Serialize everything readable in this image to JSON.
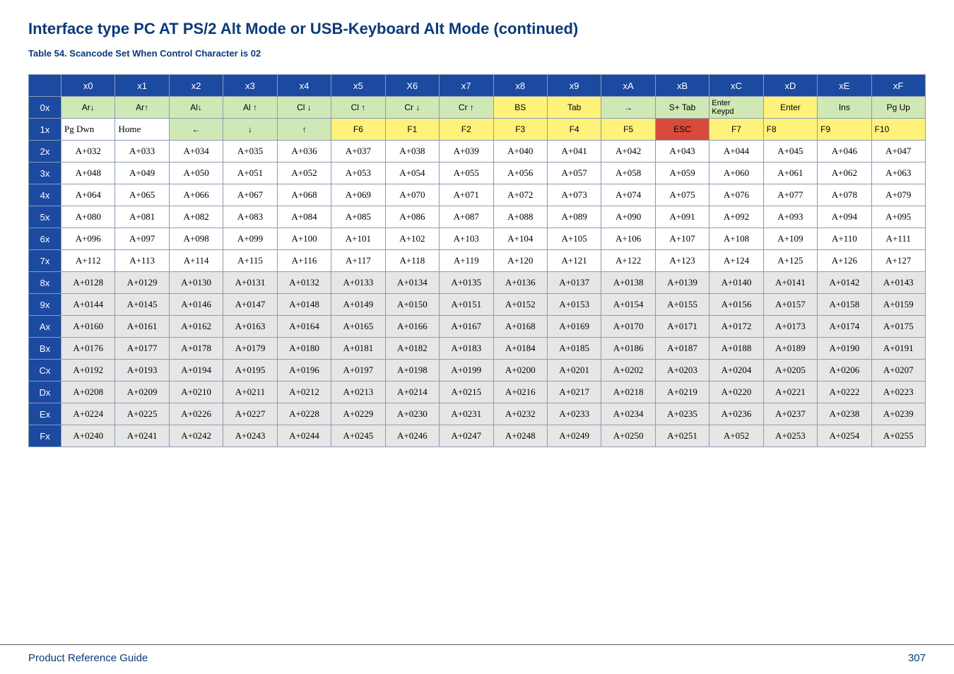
{
  "title": "Interface type PC AT PS/2 Alt Mode or USB-Keyboard Alt Mode (continued)",
  "caption": "Table 54. Scancode Set When Control Character is 02",
  "footer": {
    "left": "Product Reference Guide",
    "page": "307"
  },
  "columns": [
    "",
    "x0",
    "x1",
    "x2",
    "x3",
    "x4",
    "x5",
    "X6",
    "x7",
    "x8",
    "x9",
    "xA",
    "xB",
    "xC",
    "xD",
    "xE",
    "xF"
  ],
  "rows": [
    {
      "head": "0x",
      "shaded": true,
      "cells": [
        {
          "t": "Ar↓",
          "c": "green"
        },
        {
          "t": "Ar↑",
          "c": "green"
        },
        {
          "t": "Al↓",
          "c": "green"
        },
        {
          "t": "Al ↑",
          "c": "green"
        },
        {
          "t": "Cl ↓",
          "c": "green"
        },
        {
          "t": "Cl ↑",
          "c": "green"
        },
        {
          "t": "Cr ↓",
          "c": "green"
        },
        {
          "t": "Cr ↑",
          "c": "green"
        },
        {
          "t": "BS",
          "c": "yellow"
        },
        {
          "t": "Tab",
          "c": "yellow"
        },
        {
          "t": "→",
          "c": "green"
        },
        {
          "t": "S+ Tab",
          "c": "green"
        },
        {
          "t": "Enter Keypd",
          "c": "ec"
        },
        {
          "t": "Enter",
          "c": "yellow"
        },
        {
          "t": "Ins",
          "c": "green"
        },
        {
          "t": "Pg Up",
          "c": "green"
        }
      ]
    },
    {
      "head": "1x",
      "shaded": false,
      "cells": [
        {
          "t": "Pg Dwn",
          "c": "pgdwn"
        },
        {
          "t": "Home",
          "c": "home"
        },
        {
          "t": "←",
          "c": "green"
        },
        {
          "t": "↓",
          "c": "green"
        },
        {
          "t": "↑",
          "c": "green"
        },
        {
          "t": "F6",
          "c": "yellow"
        },
        {
          "t": "F1",
          "c": "yellow"
        },
        {
          "t": "F2",
          "c": "yellow"
        },
        {
          "t": "F3",
          "c": "yellow"
        },
        {
          "t": "F4",
          "c": "yellow"
        },
        {
          "t": "F5",
          "c": "yellow"
        },
        {
          "t": "ESC",
          "c": "red"
        },
        {
          "t": "F7",
          "c": "yellow"
        },
        {
          "t": "F8",
          "c": "yellowL"
        },
        {
          "t": "F9",
          "c": "yellowL"
        },
        {
          "t": "F10",
          "c": "yellowL"
        }
      ]
    },
    {
      "head": "2x",
      "shaded": false,
      "cells": [
        {
          "t": "A+032"
        },
        {
          "t": "A+033"
        },
        {
          "t": "A+034"
        },
        {
          "t": "A+035"
        },
        {
          "t": "A+036"
        },
        {
          "t": "A+037"
        },
        {
          "t": "A+038"
        },
        {
          "t": "A+039"
        },
        {
          "t": "A+040"
        },
        {
          "t": "A+041"
        },
        {
          "t": "A+042"
        },
        {
          "t": "A+043"
        },
        {
          "t": "A+044"
        },
        {
          "t": "A+045"
        },
        {
          "t": "A+046"
        },
        {
          "t": "A+047"
        }
      ]
    },
    {
      "head": "3x",
      "shaded": false,
      "cells": [
        {
          "t": "A+048"
        },
        {
          "t": "A+049"
        },
        {
          "t": "A+050"
        },
        {
          "t": "A+051"
        },
        {
          "t": "A+052"
        },
        {
          "t": "A+053"
        },
        {
          "t": "A+054"
        },
        {
          "t": "A+055"
        },
        {
          "t": "A+056"
        },
        {
          "t": "A+057"
        },
        {
          "t": "A+058"
        },
        {
          "t": "A+059"
        },
        {
          "t": "A+060"
        },
        {
          "t": "A+061"
        },
        {
          "t": "A+062"
        },
        {
          "t": "A+063"
        }
      ]
    },
    {
      "head": "4x",
      "shaded": false,
      "cells": [
        {
          "t": "A+064"
        },
        {
          "t": "A+065"
        },
        {
          "t": "A+066"
        },
        {
          "t": "A+067"
        },
        {
          "t": "A+068"
        },
        {
          "t": "A+069"
        },
        {
          "t": "A+070"
        },
        {
          "t": "A+071"
        },
        {
          "t": "A+072"
        },
        {
          "t": "A+073"
        },
        {
          "t": "A+074"
        },
        {
          "t": "A+075"
        },
        {
          "t": "A+076"
        },
        {
          "t": "A+077"
        },
        {
          "t": "A+078"
        },
        {
          "t": "A+079"
        }
      ]
    },
    {
      "head": "5x",
      "shaded": false,
      "cells": [
        {
          "t": "A+080"
        },
        {
          "t": "A+081"
        },
        {
          "t": "A+082"
        },
        {
          "t": "A+083"
        },
        {
          "t": "A+084"
        },
        {
          "t": "A+085"
        },
        {
          "t": "A+086"
        },
        {
          "t": "A+087"
        },
        {
          "t": "A+088"
        },
        {
          "t": "A+089"
        },
        {
          "t": "A+090"
        },
        {
          "t": "A+091"
        },
        {
          "t": "A+092"
        },
        {
          "t": "A+093"
        },
        {
          "t": "A+094"
        },
        {
          "t": "A+095"
        }
      ]
    },
    {
      "head": "6x",
      "shaded": false,
      "cells": [
        {
          "t": "A+096"
        },
        {
          "t": "A+097"
        },
        {
          "t": "A+098"
        },
        {
          "t": "A+099"
        },
        {
          "t": "A+100"
        },
        {
          "t": "A+101"
        },
        {
          "t": "A+102"
        },
        {
          "t": "A+103"
        },
        {
          "t": "A+104"
        },
        {
          "t": "A+105"
        },
        {
          "t": "A+106"
        },
        {
          "t": "A+107"
        },
        {
          "t": "A+108"
        },
        {
          "t": "A+109"
        },
        {
          "t": "A+110"
        },
        {
          "t": "A+111"
        }
      ]
    },
    {
      "head": "7x",
      "shaded": false,
      "cells": [
        {
          "t": "A+112"
        },
        {
          "t": "A+113"
        },
        {
          "t": "A+114"
        },
        {
          "t": "A+115"
        },
        {
          "t": "A+116"
        },
        {
          "t": "A+117"
        },
        {
          "t": "A+118"
        },
        {
          "t": "A+119"
        },
        {
          "t": "A+120"
        },
        {
          "t": "A+121"
        },
        {
          "t": "A+122"
        },
        {
          "t": "A+123"
        },
        {
          "t": "A+124"
        },
        {
          "t": "A+125"
        },
        {
          "t": "A+126"
        },
        {
          "t": "A+127"
        }
      ]
    },
    {
      "head": "8x",
      "shaded": true,
      "cells": [
        {
          "t": "A+0128"
        },
        {
          "t": "A+0129"
        },
        {
          "t": "A+0130"
        },
        {
          "t": "A+0131"
        },
        {
          "t": "A+0132"
        },
        {
          "t": "A+0133"
        },
        {
          "t": "A+0134"
        },
        {
          "t": "A+0135"
        },
        {
          "t": "A+0136"
        },
        {
          "t": "A+0137"
        },
        {
          "t": "A+0138"
        },
        {
          "t": "A+0139"
        },
        {
          "t": "A+0140"
        },
        {
          "t": "A+0141"
        },
        {
          "t": "A+0142"
        },
        {
          "t": "A+0143"
        }
      ]
    },
    {
      "head": "9x",
      "shaded": true,
      "cells": [
        {
          "t": "A+0144"
        },
        {
          "t": "A+0145"
        },
        {
          "t": "A+0146"
        },
        {
          "t": "A+0147"
        },
        {
          "t": "A+0148"
        },
        {
          "t": "A+0149"
        },
        {
          "t": "A+0150"
        },
        {
          "t": "A+0151"
        },
        {
          "t": "A+0152"
        },
        {
          "t": "A+0153"
        },
        {
          "t": "A+0154"
        },
        {
          "t": "A+0155"
        },
        {
          "t": "A+0156"
        },
        {
          "t": "A+0157"
        },
        {
          "t": "A+0158"
        },
        {
          "t": "A+0159"
        }
      ]
    },
    {
      "head": "Ax",
      "shaded": true,
      "cells": [
        {
          "t": "A+0160"
        },
        {
          "t": "A+0161"
        },
        {
          "t": "A+0162"
        },
        {
          "t": "A+0163"
        },
        {
          "t": "A+0164"
        },
        {
          "t": "A+0165"
        },
        {
          "t": "A+0166"
        },
        {
          "t": "A+0167"
        },
        {
          "t": "A+0168"
        },
        {
          "t": "A+0169"
        },
        {
          "t": "A+0170"
        },
        {
          "t": "A+0171"
        },
        {
          "t": "A+0172"
        },
        {
          "t": "A+0173"
        },
        {
          "t": "A+0174"
        },
        {
          "t": "A+0175"
        }
      ]
    },
    {
      "head": "Bx",
      "shaded": true,
      "cells": [
        {
          "t": "A+0176"
        },
        {
          "t": "A+0177"
        },
        {
          "t": "A+0178"
        },
        {
          "t": "A+0179"
        },
        {
          "t": "A+0180"
        },
        {
          "t": "A+0181"
        },
        {
          "t": "A+0182"
        },
        {
          "t": "A+0183"
        },
        {
          "t": "A+0184"
        },
        {
          "t": "A+0185"
        },
        {
          "t": "A+0186"
        },
        {
          "t": "A+0187"
        },
        {
          "t": "A+0188"
        },
        {
          "t": "A+0189"
        },
        {
          "t": "A+0190"
        },
        {
          "t": "A+0191"
        }
      ]
    },
    {
      "head": "Cx",
      "shaded": true,
      "cells": [
        {
          "t": "A+0192"
        },
        {
          "t": "A+0193"
        },
        {
          "t": "A+0194"
        },
        {
          "t": "A+0195"
        },
        {
          "t": "A+0196"
        },
        {
          "t": "A+0197"
        },
        {
          "t": "A+0198"
        },
        {
          "t": "A+0199"
        },
        {
          "t": "A+0200"
        },
        {
          "t": "A+0201"
        },
        {
          "t": "A+0202"
        },
        {
          "t": "A+0203"
        },
        {
          "t": "A+0204"
        },
        {
          "t": "A+0205"
        },
        {
          "t": "A+0206"
        },
        {
          "t": "A+0207"
        }
      ]
    },
    {
      "head": "Dx",
      "shaded": true,
      "cells": [
        {
          "t": "A+0208"
        },
        {
          "t": "A+0209"
        },
        {
          "t": "A+0210"
        },
        {
          "t": "A+0211"
        },
        {
          "t": "A+0212"
        },
        {
          "t": "A+0213"
        },
        {
          "t": "A+0214"
        },
        {
          "t": "A+0215"
        },
        {
          "t": "A+0216"
        },
        {
          "t": "A+0217"
        },
        {
          "t": "A+0218"
        },
        {
          "t": "A+0219"
        },
        {
          "t": "A+0220"
        },
        {
          "t": "A+0221"
        },
        {
          "t": "A+0222"
        },
        {
          "t": "A+0223"
        }
      ]
    },
    {
      "head": "Ex",
      "shaded": true,
      "cells": [
        {
          "t": "A+0224"
        },
        {
          "t": "A+0225"
        },
        {
          "t": "A+0226"
        },
        {
          "t": "A+0227"
        },
        {
          "t": "A+0228"
        },
        {
          "t": "A+0229"
        },
        {
          "t": "A+0230"
        },
        {
          "t": "A+0231"
        },
        {
          "t": "A+0232"
        },
        {
          "t": "A+0233"
        },
        {
          "t": "A+0234"
        },
        {
          "t": "A+0235"
        },
        {
          "t": "A+0236"
        },
        {
          "t": "A+0237"
        },
        {
          "t": "A+0238"
        },
        {
          "t": "A+0239"
        }
      ]
    },
    {
      "head": "Fx",
      "shaded": true,
      "cells": [
        {
          "t": "A+0240"
        },
        {
          "t": "A+0241"
        },
        {
          "t": "A+0242"
        },
        {
          "t": "A+0243"
        },
        {
          "t": "A+0244"
        },
        {
          "t": "A+0245"
        },
        {
          "t": "A+0246"
        },
        {
          "t": "A+0247"
        },
        {
          "t": "A+0248"
        },
        {
          "t": "A+0249"
        },
        {
          "t": "A+0250"
        },
        {
          "t": "A+0251"
        },
        {
          "t": "A+052"
        },
        {
          "t": "A+0253"
        },
        {
          "t": "A+0254"
        },
        {
          "t": "A+0255"
        }
      ]
    }
  ]
}
